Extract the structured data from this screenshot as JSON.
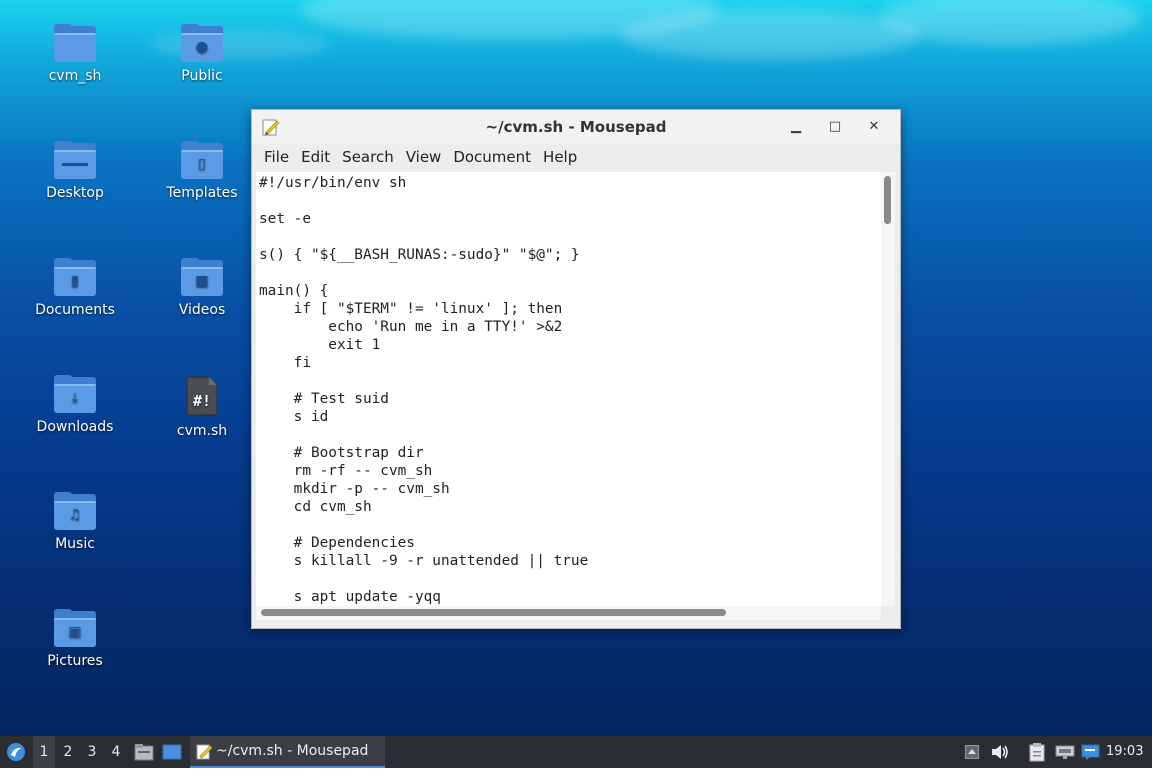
{
  "desktop": {
    "icons": [
      {
        "label": "cvm_sh",
        "icon": "folder-icon"
      },
      {
        "label": "Public",
        "icon": "folder-public-icon"
      },
      {
        "label": "Desktop",
        "icon": "folder-desktop-icon"
      },
      {
        "label": "Templates",
        "icon": "folder-templates-icon"
      },
      {
        "label": "Documents",
        "icon": "folder-documents-icon"
      },
      {
        "label": "Videos",
        "icon": "folder-videos-icon"
      },
      {
        "label": "Downloads",
        "icon": "folder-downloads-icon"
      },
      {
        "label": "cvm.sh",
        "icon": "shell-script-icon"
      },
      {
        "label": "Music",
        "icon": "folder-music-icon"
      },
      {
        "label": "Pictures",
        "icon": "folder-pictures-icon"
      }
    ]
  },
  "window": {
    "title": "~/cvm.sh - Mousepad",
    "menu": [
      "File",
      "Edit",
      "Search",
      "View",
      "Document",
      "Help"
    ],
    "controls": {
      "minimize": "minimize-icon",
      "maximize": "maximize-icon",
      "close": "close-icon"
    },
    "editor_lines": [
      "#!/usr/bin/env sh",
      "",
      "set -e",
      "",
      "s() { \"${__BASH_RUNAS:-sudo}\" \"$@\"; }",
      "",
      "main() {",
      "    if [ \"$TERM\" != 'linux' ]; then",
      "        echo 'Run me in a TTY!' >&2",
      "        exit 1",
      "    fi",
      "",
      "    # Test suid",
      "    s id",
      "",
      "    # Bootstrap dir",
      "    rm -rf -- cvm_sh",
      "    mkdir -p -- cvm_sh",
      "    cd cvm_sh",
      "",
      "    # Dependencies",
      "    s killall -9 -r unattended || true",
      "",
      "    s apt update -yqq"
    ]
  },
  "taskbar": {
    "workspaces": [
      "1",
      "2",
      "3",
      "4"
    ],
    "active_workspace": "1",
    "task_label": "~/cvm.sh - Mousepad",
    "clock": "19:03",
    "tray_icons": [
      "tray-up-arrow-icon",
      "volume-icon",
      "clipboard-icon",
      "network-icon",
      "chat-icon"
    ]
  }
}
